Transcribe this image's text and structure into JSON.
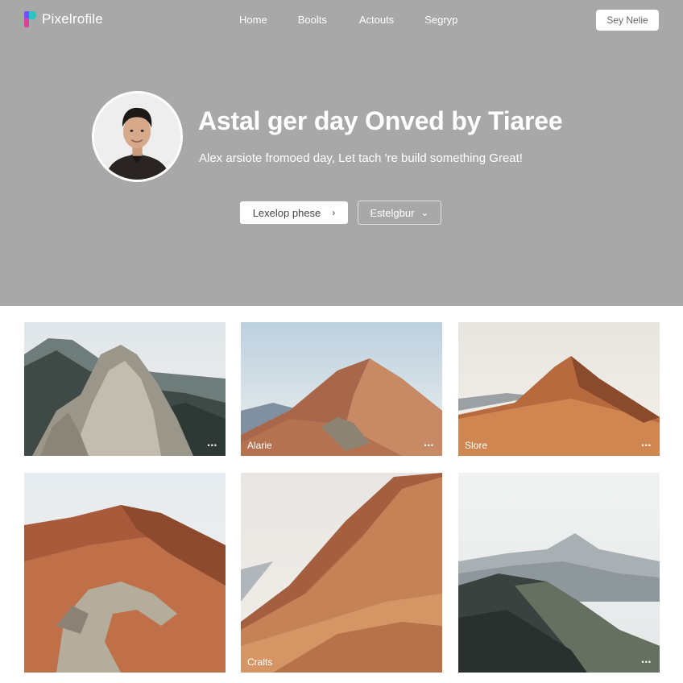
{
  "brand": {
    "name": "Pixelrofile",
    "logo_icon": "gradient-p-logo-icon"
  },
  "nav": {
    "items": [
      "Home",
      "Boolts",
      "Actouts",
      "Segryp"
    ]
  },
  "header": {
    "cta_label": "Sey Nelie"
  },
  "hero": {
    "title": "Astal ger day Onved by Tiaree",
    "subtitle": "Alex arsiote fromoed day, Let tach 're build something Great!",
    "primary_button": "Lexelop phese",
    "primary_icon": "chevron-right-icon",
    "secondary_button": "Estelgbur",
    "secondary_icon": "chevron-down-icon"
  },
  "gallery": {
    "items": [
      {
        "label": "",
        "more": "•••"
      },
      {
        "label": "Alarie",
        "more": "•••"
      },
      {
        "label": "Slore",
        "more": "•••"
      },
      {
        "label": "",
        "more": ""
      },
      {
        "label": "Cralts",
        "more": ""
      },
      {
        "label": "",
        "more": "•••"
      }
    ]
  },
  "colors": {
    "hero_bg": "#a8a8a8",
    "page_bg": "#ffffff",
    "accent_text": "#ffffff"
  }
}
